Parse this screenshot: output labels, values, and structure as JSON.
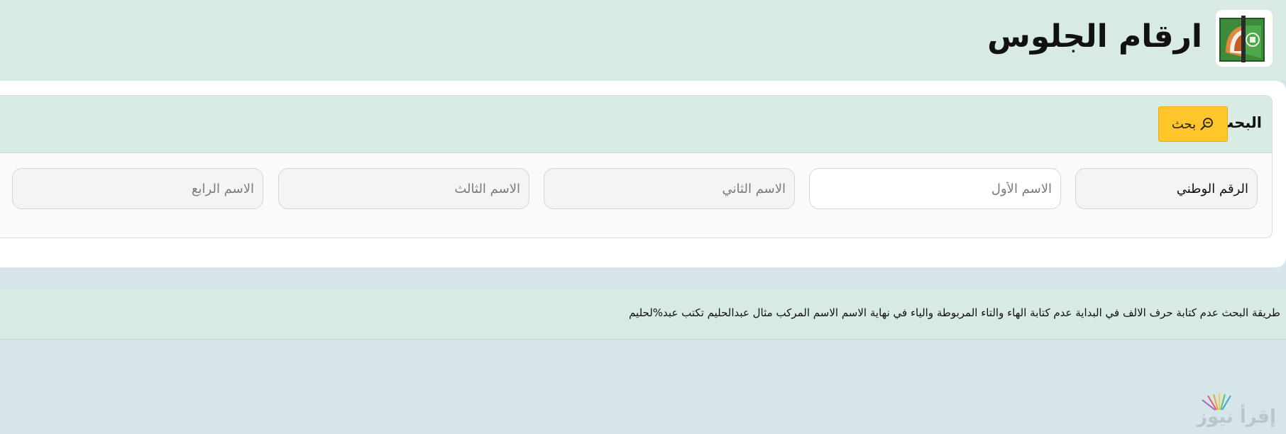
{
  "header": {
    "title": "ارقام الجلوس",
    "logo_icon": "university-emblem-icon"
  },
  "search_card": {
    "title": "البحث",
    "button_label": "بحث",
    "button_icon": "search-icon",
    "accent_color": "#ffc62b"
  },
  "fields": {
    "national_id": {
      "placeholder": "الرقم الوطني",
      "value": ""
    },
    "first_name": {
      "placeholder": "الاسم الأول",
      "value": ""
    },
    "second_name": {
      "placeholder": "الاسم الثاني",
      "value": ""
    },
    "third_name": {
      "placeholder": "الاسم الثالث",
      "value": ""
    },
    "fourth_name": {
      "placeholder": "الاسم الرابع",
      "value": ""
    }
  },
  "note": {
    "text": "طريقة البحث عدم كتابة حرف الالف في البداية عدم كتابة الهاء والتاء المربوطة والياء في نهاية الاسم الاسم المركب مثال عبدالحليم تكتب عبد%لحليم"
  },
  "watermark": {
    "text": "إقرأ نيوز"
  }
}
